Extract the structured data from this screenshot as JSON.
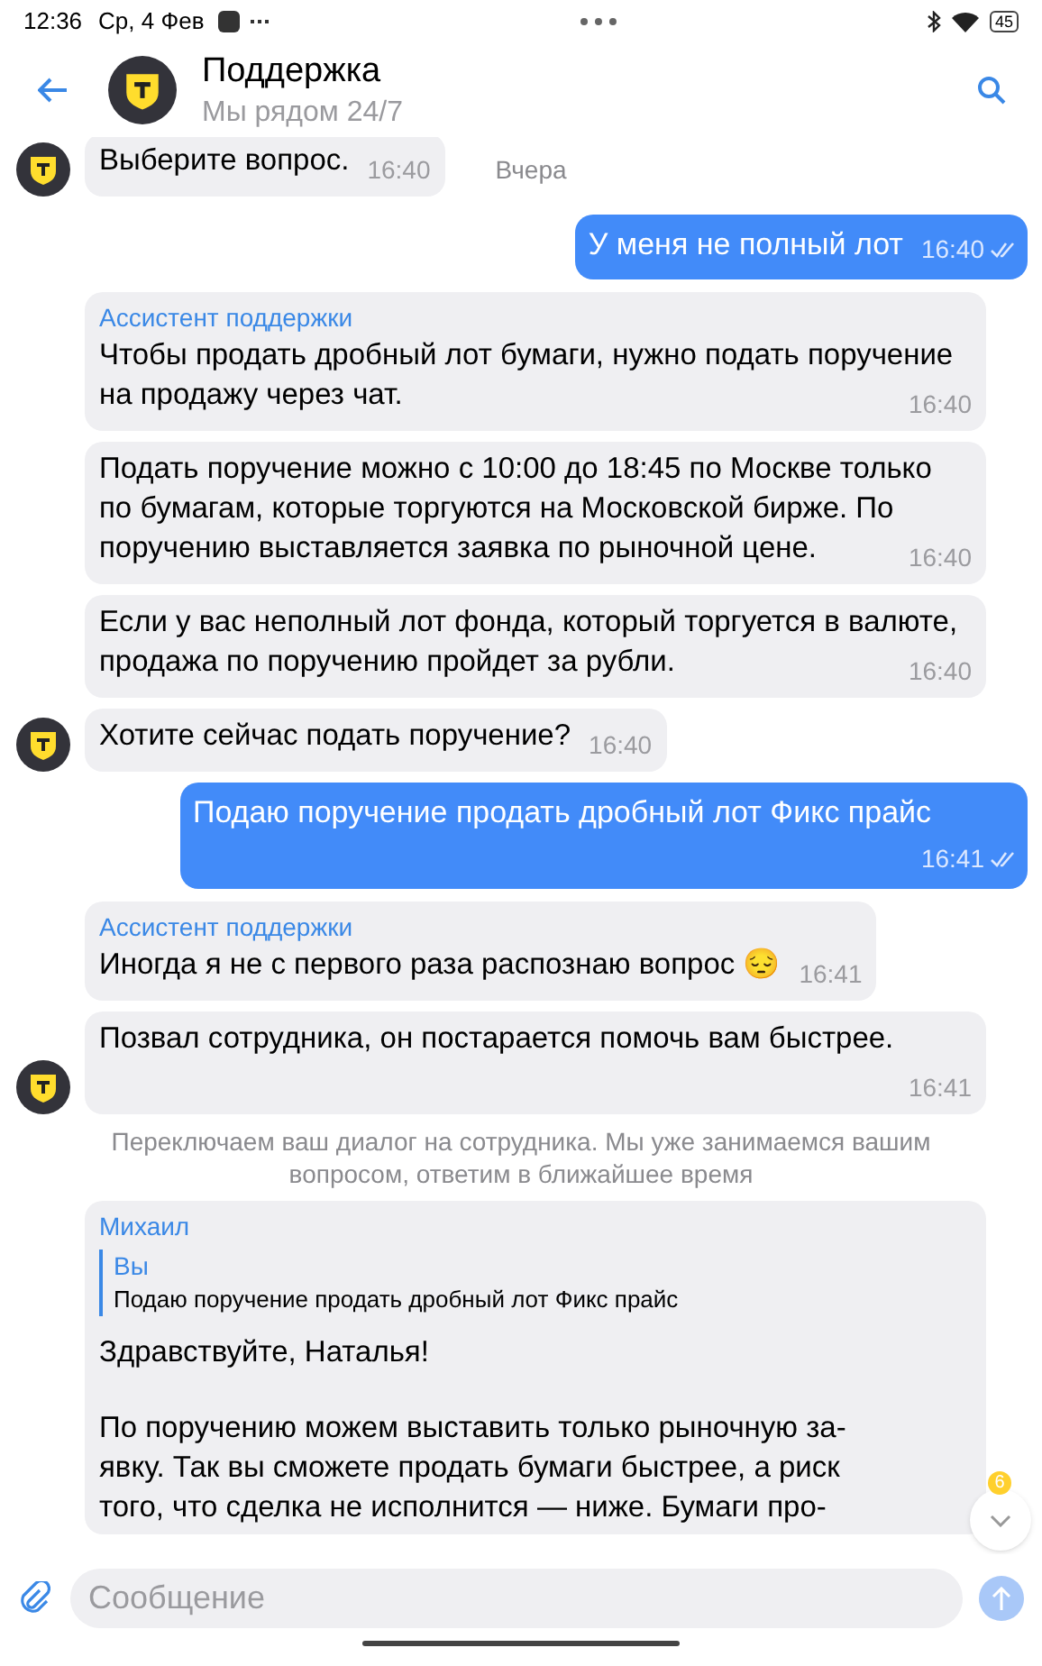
{
  "status_bar": {
    "time": "12:36",
    "date": "Ср, 4 Фев",
    "battery": "45"
  },
  "header": {
    "title": "Поддержка",
    "subtitle": "Мы рядом 24/7"
  },
  "date_label": "Вчера",
  "messages": [
    {
      "kind": "in",
      "avatar": true,
      "text": "Выберите вопрос.",
      "time": "16:40"
    },
    {
      "kind": "out",
      "text": "У меня не полный лот",
      "time": "16:40",
      "read": true
    },
    {
      "kind": "in",
      "avatar": false,
      "sender": "Ассистент поддержки",
      "text": "Чтобы продать дробный лот бумаги, нужно подать поручение на продажу через чат.",
      "time": "16:40"
    },
    {
      "kind": "in",
      "avatar": false,
      "text": "Подать поручение можно с 10:00 до 18:45 по Москве только по бумагам, которые торгуются на Московской бирже. По поручению выставляется заявка по рыночной цене.",
      "time": "16:40"
    },
    {
      "kind": "in",
      "avatar": false,
      "text": "Если у вас неполный лот фонда, который торгуется в валюте, продажа по поручению пройдет за рубли.",
      "time": "16:40"
    },
    {
      "kind": "in",
      "avatar": true,
      "text": "Хотите сейчас подать поручение?",
      "time": "16:40"
    },
    {
      "kind": "out",
      "text": "Подаю поручение продать дробный лот Фикс прайс",
      "time": "16:41",
      "read": true
    },
    {
      "kind": "in",
      "avatar": false,
      "sender": "Ассистент поддержки",
      "text": "Иногда я не с первого раза распознаю вопрос 😔",
      "time": "16:41"
    },
    {
      "kind": "in",
      "avatar": true,
      "text": "Позвал сотрудника, он постарается помочь вам быстрее.",
      "time": "16:41"
    },
    {
      "kind": "system",
      "text": "Переключаем ваш диалог на сотрудника. Мы уже занимаемся вашим вопросом, ответим в ближайшее время"
    },
    {
      "kind": "in",
      "avatar": false,
      "sender": "Михаил",
      "quote": {
        "author": "Вы",
        "text": "Подаю поручение продать дробный лот Фикс прайс"
      },
      "paragraphs": [
        [
          "Здравствуйте, Наталья!"
        ],
        [
          "По поручению можем выставить только рыночную за-",
          "явку. Так вы сможете продать бумаги быстрее, а риск",
          "того, что сделка не исполнится — ниже. Бумаги про-"
        ]
      ]
    }
  ],
  "scroll_button": {
    "badge": "6"
  },
  "composer": {
    "placeholder": "Сообщение"
  }
}
